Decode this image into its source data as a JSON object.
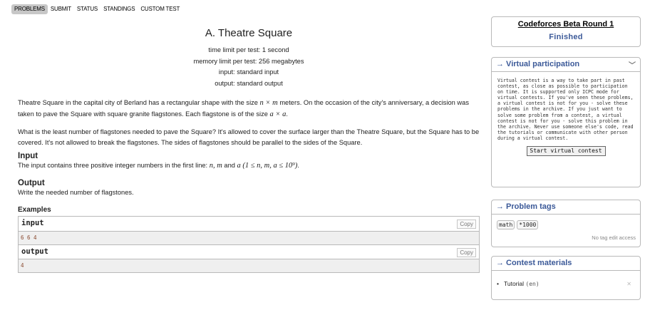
{
  "nav": {
    "items": [
      "PROBLEMS",
      "SUBMIT",
      "STATUS",
      "STANDINGS",
      "CUSTOM TEST"
    ],
    "active": "PROBLEMS"
  },
  "problem": {
    "title": "A. Theatre Square",
    "time_limit": "time limit per test: 1 second",
    "memory_limit": "memory limit per test: 256 megabytes",
    "input_file": "input: standard input",
    "output_file": "output: standard output",
    "statement_p1_a": "Theatre Square in the capital city of Berland has a rectangular shape with the size",
    "statement_p1_m1": "n × m",
    "statement_p1_b": "meters. On the occasion of the city's anniversary, a decision was taken to pave the Square with square granite flagstones. Each flagstone is of the size",
    "statement_p1_m2": "a × a",
    "statement_p1_c": ".",
    "statement_p2": "What is the least number of flagstones needed to pave the Square? It's allowed to cover the surface larger than the Theatre Square, but the Square has to be covered. It's not allowed to break the flagstones. The sides of flagstones should be parallel to the sides of the Square.",
    "input_heading": "Input",
    "input_text_a": "The input contains three positive integer numbers in the first line:",
    "input_math1": "n,  m",
    "input_text_b": "and",
    "input_math2": "a",
    "input_math3": "(1 ≤ n, m, a ≤ 10⁹)",
    "input_text_c": ".",
    "output_heading": "Output",
    "output_text": "Write the needed number of flagstones.",
    "examples_heading": "Examples",
    "sample_input_title": "input",
    "sample_input": "6 6 4",
    "sample_output_title": "output",
    "sample_output": "4",
    "copy_label": "Copy"
  },
  "sidebar": {
    "contest_name": "Codeforces Beta Round 1",
    "contest_status": "Finished",
    "virtual_title": "→ Virtual participation",
    "virtual_text": "Virtual contest is a way to take part in past contest, as close as possible to participation on time. It is supported only ICPC mode for virtual contests. If you've seen these problems, a virtual contest is not for you - solve these problems in the archive. If you just want to solve some problem from a contest, a virtual contest is not for you - solve this problem in the archive. Never use someone else's code, read the tutorials or communicate with other person during a virtual contest.",
    "virtual_button": "Start virtual contest",
    "tags_title": "→ Problem tags",
    "tags": [
      "math",
      "*1000"
    ],
    "tags_note": "No tag edit access",
    "materials_title": "→ Contest materials",
    "materials": [
      {
        "label": "Tutorial",
        "lang": "(en)"
      }
    ]
  }
}
